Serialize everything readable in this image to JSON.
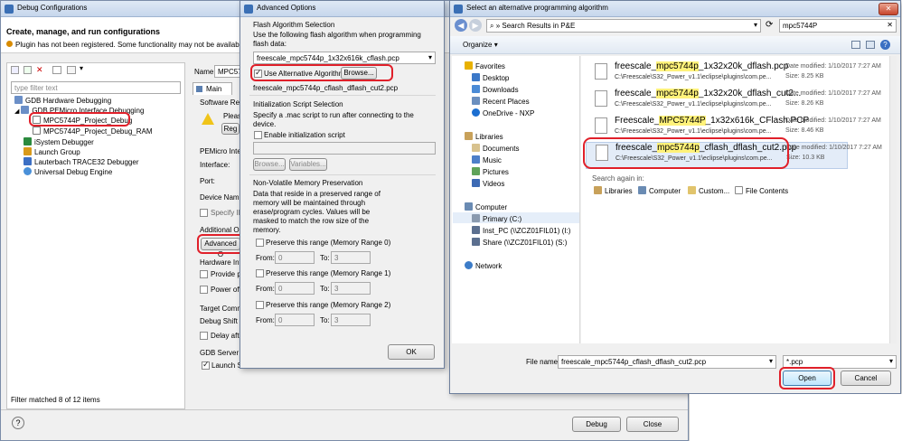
{
  "debug_dialog": {
    "title": "Debug Configurations",
    "header_title": "Create, manage, and run configurations",
    "warning": "Plugin has not been registered. Some functionality may not be available.",
    "filter_placeholder": "type filter text",
    "tree": [
      "GDB Hardware Debugging",
      "GDB PEMicro Interface Debugging",
      "MPC5744P_Project_Debug",
      "MPC5744P_Project_Debug_RAM",
      "iSystem Debugger",
      "Launch Group",
      "Lauterbach TRACE32 Debugger",
      "Universal Debug Engine"
    ],
    "filter_status": "Filter matched 8 of 12 items",
    "name_label": "Name:",
    "name_value": "MPC57",
    "main_tab": "Main",
    "software_reg": "Software Reg",
    "please": "Pleas",
    "reg_button": "Reg",
    "pemicro_inte": "PEMicro Inte",
    "interface_label": "Interface:",
    "port_label": "Port:",
    "device_name": "Device Name",
    "specify_ip": "Specify IP",
    "additional_o": "Additional O",
    "advanced_btn": "Advanced O",
    "hardware_int": "Hardware Int",
    "provide_p": "Provide p",
    "power_off": "Power off",
    "target_comm": "Target Comm",
    "debug_shift": "Debug Shift",
    "delay_after": "Delay afte",
    "gdb_server": "GDB Server S",
    "launch_s": "Launch S",
    "debug_button": "Debug",
    "close_button": "Close"
  },
  "advanced_dialog": {
    "title": "Advanced Options",
    "flash_section": "Flash Algorithm Selection",
    "flash_desc": "Use the following flash algorithm when programming flash data:",
    "flash_select": "freescale_mpc5744p_1x32x616k_cflash.pcp",
    "use_alt_label": "Use Alternative Algorithm",
    "browse_label": "Browse...",
    "alt_path": "freescale_mpc5744p_cflash_dflash_cut2.pcp",
    "init_section": "Initialization Script Selection",
    "init_desc": "Specify a .mac script to run after connecting to the device.",
    "enable_init": "Enable initialization script",
    "browse2": "Browse...",
    "variables": "Variables...",
    "nvm_section": "Non-Volatile Memory Preservation",
    "nvm_desc": "Data that reside in a preserved range of memory will be maintained through erase/program cycles. Values will be masked to match the row size of the memory.",
    "ranges": [
      {
        "label": "Preserve this range (Memory Range 0)",
        "from": "0",
        "to": "3"
      },
      {
        "label": "Preserve this range (Memory Range 1)",
        "from": "0",
        "to": "3"
      },
      {
        "label": "Preserve this range (Memory Range 2)",
        "from": "0",
        "to": "3"
      }
    ],
    "from_label": "From:",
    "to_label": "To:",
    "ok_button": "OK"
  },
  "file_dialog": {
    "title": "Select an alternative programming algorithm",
    "address": "Search Results in P&E",
    "search_value": "mpc5744P",
    "organize": "Organize",
    "nav": {
      "favorites": "Favorites",
      "desktop": "Desktop",
      "downloads": "Downloads",
      "recent": "Recent Places",
      "onedrive": "OneDrive - NXP",
      "libraries": "Libraries",
      "documents": "Documents",
      "music": "Music",
      "pictures": "Pictures",
      "videos": "Videos",
      "computer": "Computer",
      "primary": "Primary (C:)",
      "inst_pc": "Inst_PC (\\\\ZCZ01FIL01) (I:)",
      "share": "Share (\\\\ZCZ01FIL01) (S:)",
      "network": "Network"
    },
    "files": [
      {
        "pre": "freescale_",
        "hl": "mpc5744p",
        "post": "_1x32x20k_dflash.pcp",
        "path": "C:\\Freescale\\S32_Power_v1.1\\eclipse\\plugins\\com.pe...",
        "date": "Date modified: 1/10/2017 7:27 AM",
        "size": "Size: 8.25 KB"
      },
      {
        "pre": "freescale_",
        "hl": "mpc5744p",
        "post": "_1x32x20k_dflash_cut2...",
        "path": "C:\\Freescale\\S32_Power_v1.1\\eclipse\\plugins\\com.pe...",
        "date": "Date modified: 1/10/2017 7:27 AM",
        "size": "Size: 8.26 KB"
      },
      {
        "pre": "Freescale_",
        "hl": "MPC5744P",
        "post": "_1x32x616k_CFlash.PCP",
        "path": "C:\\Freescale\\S32_Power_v1.1\\eclipse\\plugins\\com.pe...",
        "date": "Date modified: 1/10/2017 7:27 AM",
        "size": "Size: 8.46 KB"
      },
      {
        "pre": "freescale_",
        "hl": "mpc5744p",
        "post": "_cflash_dflash_cut2.pcp",
        "path": "C:\\Freescale\\S32_Power_v1.1\\eclipse\\plugins\\com.pe...",
        "date": "Date modified: 1/10/2017 7:27 AM",
        "size": "Size: 10.3 KB"
      }
    ],
    "search_again": "Search again in:",
    "search_locations": [
      "Libraries",
      "Computer",
      "Custom...",
      "File Contents"
    ],
    "filename_label": "File name:",
    "filename_value": "freescale_mpc5744p_cflash_dflash_cut2.pcp",
    "filter_value": "*.pcp",
    "open_button": "Open",
    "cancel_button": "Cancel"
  },
  "colors": {
    "highlight_ring": "#e0202a",
    "search_highlight": "#fff27a",
    "selection": "#cde4f7"
  }
}
